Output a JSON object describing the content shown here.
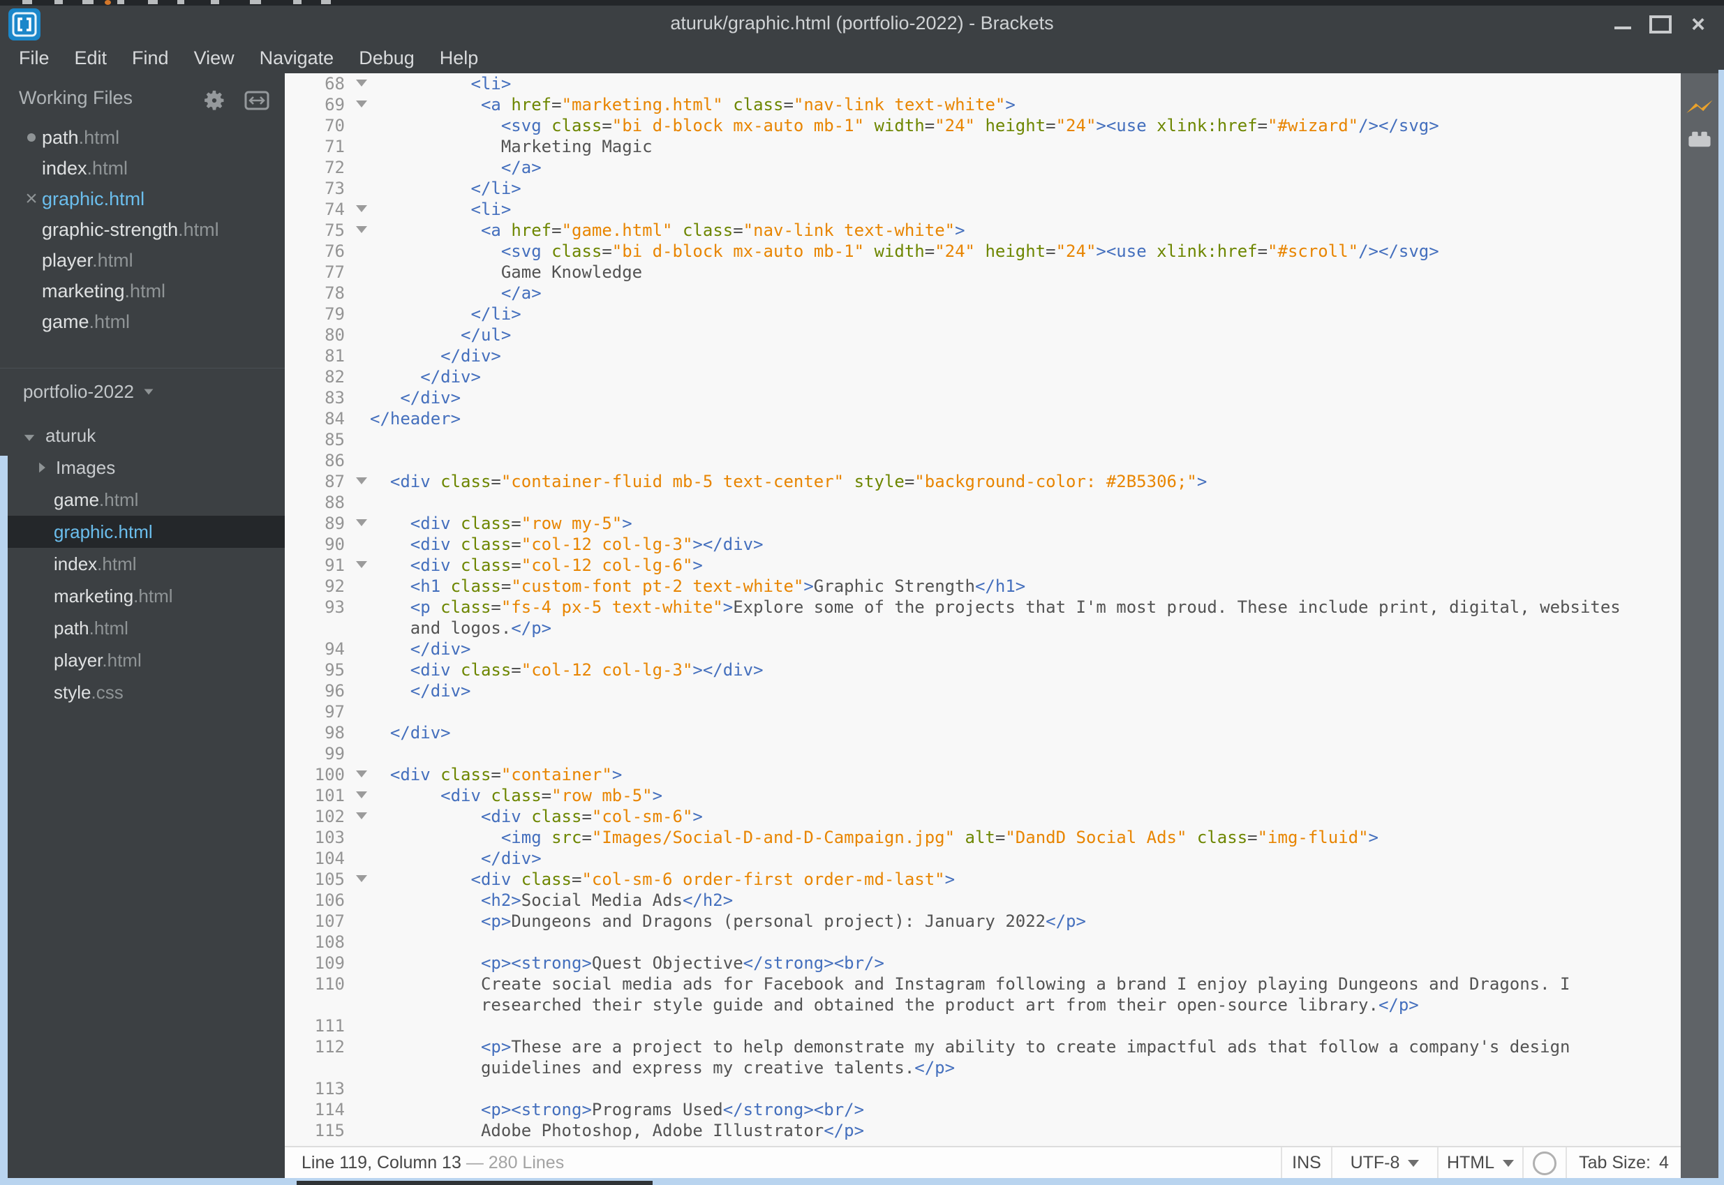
{
  "window": {
    "title": "aturuk/graphic.html (portfolio-2022) - Brackets",
    "controls": {
      "minimize": "minimize",
      "maximize": "maximize",
      "close": "close"
    }
  },
  "menubar": {
    "items": [
      "File",
      "Edit",
      "Find",
      "View",
      "Navigate",
      "Debug",
      "Help"
    ]
  },
  "sidebar": {
    "working_files_label": "Working Files",
    "working_files": [
      {
        "name": "path",
        "ext": ".html",
        "indicator": "dot"
      },
      {
        "name": "index",
        "ext": ".html",
        "indicator": "none"
      },
      {
        "name": "graphic",
        "ext": ".html",
        "indicator": "close",
        "active": true
      },
      {
        "name": "graphic-strength",
        "ext": ".html",
        "indicator": "none"
      },
      {
        "name": "player",
        "ext": ".html",
        "indicator": "none"
      },
      {
        "name": "marketing",
        "ext": ".html",
        "indicator": "none"
      },
      {
        "name": "game",
        "ext": ".html",
        "indicator": "none"
      }
    ],
    "project": {
      "name": "portfolio-2022"
    },
    "tree": [
      {
        "kind": "folder-open",
        "label": "aturuk",
        "level": 0
      },
      {
        "kind": "folder-closed",
        "label": "Images",
        "level": 1
      },
      {
        "kind": "file",
        "name": "game",
        "ext": ".html",
        "level": 1
      },
      {
        "kind": "file",
        "name": "graphic",
        "ext": ".html",
        "level": 1,
        "selected": true
      },
      {
        "kind": "file",
        "name": "index",
        "ext": ".html",
        "level": 1
      },
      {
        "kind": "file",
        "name": "marketing",
        "ext": ".html",
        "level": 1
      },
      {
        "kind": "file",
        "name": "path",
        "ext": ".html",
        "level": 1
      },
      {
        "kind": "file",
        "name": "player",
        "ext": ".html",
        "level": 1
      },
      {
        "kind": "file",
        "name": "style",
        "ext": ".css",
        "level": 1
      }
    ]
  },
  "editor": {
    "rows": [
      {
        "n": "68",
        "fold": true,
        "ind": 10,
        "seg": [
          [
            "t",
            "<li>"
          ]
        ]
      },
      {
        "n": "69",
        "fold": true,
        "ind": 11,
        "seg": [
          [
            "t",
            "<a"
          ],
          [
            "x",
            " "
          ],
          [
            "a",
            "href"
          ],
          [
            "p",
            "="
          ],
          [
            "s",
            "\"marketing.html\""
          ],
          [
            "x",
            " "
          ],
          [
            "a",
            "class"
          ],
          [
            "p",
            "="
          ],
          [
            "s",
            "\"nav-link text-white\""
          ],
          [
            "t",
            ">"
          ]
        ]
      },
      {
        "n": "70",
        "ind": 13,
        "seg": [
          [
            "t",
            "<svg"
          ],
          [
            "x",
            " "
          ],
          [
            "a",
            "class"
          ],
          [
            "p",
            "="
          ],
          [
            "s",
            "\"bi d-block mx-auto mb-1\""
          ],
          [
            "x",
            " "
          ],
          [
            "a",
            "width"
          ],
          [
            "p",
            "="
          ],
          [
            "s",
            "\"24\""
          ],
          [
            "x",
            " "
          ],
          [
            "a",
            "height"
          ],
          [
            "p",
            "="
          ],
          [
            "s",
            "\"24\""
          ],
          [
            "t",
            "><use"
          ],
          [
            "x",
            " "
          ],
          [
            "a",
            "xlink:href"
          ],
          [
            "p",
            "="
          ],
          [
            "s",
            "\"#wizard\""
          ],
          [
            "t",
            "/></svg>"
          ]
        ]
      },
      {
        "n": "71",
        "ind": 13,
        "seg": [
          [
            "x",
            "Marketing Magic"
          ]
        ]
      },
      {
        "n": "72",
        "ind": 13,
        "seg": [
          [
            "t",
            "</a>"
          ]
        ]
      },
      {
        "n": "73",
        "ind": 10,
        "seg": [
          [
            "t",
            "</li>"
          ]
        ]
      },
      {
        "n": "74",
        "fold": true,
        "ind": 10,
        "seg": [
          [
            "t",
            "<li>"
          ]
        ]
      },
      {
        "n": "75",
        "fold": true,
        "ind": 11,
        "seg": [
          [
            "t",
            "<a"
          ],
          [
            "x",
            " "
          ],
          [
            "a",
            "href"
          ],
          [
            "p",
            "="
          ],
          [
            "s",
            "\"game.html\""
          ],
          [
            "x",
            " "
          ],
          [
            "a",
            "class"
          ],
          [
            "p",
            "="
          ],
          [
            "s",
            "\"nav-link text-white\""
          ],
          [
            "t",
            ">"
          ]
        ]
      },
      {
        "n": "76",
        "ind": 13,
        "seg": [
          [
            "t",
            "<svg"
          ],
          [
            "x",
            " "
          ],
          [
            "a",
            "class"
          ],
          [
            "p",
            "="
          ],
          [
            "s",
            "\"bi d-block mx-auto mb-1\""
          ],
          [
            "x",
            " "
          ],
          [
            "a",
            "width"
          ],
          [
            "p",
            "="
          ],
          [
            "s",
            "\"24\""
          ],
          [
            "x",
            " "
          ],
          [
            "a",
            "height"
          ],
          [
            "p",
            "="
          ],
          [
            "s",
            "\"24\""
          ],
          [
            "t",
            "><use"
          ],
          [
            "x",
            " "
          ],
          [
            "a",
            "xlink:href"
          ],
          [
            "p",
            "="
          ],
          [
            "s",
            "\"#scroll\""
          ],
          [
            "t",
            "/></svg>"
          ]
        ]
      },
      {
        "n": "77",
        "ind": 13,
        "seg": [
          [
            "x",
            "Game Knowledge"
          ]
        ]
      },
      {
        "n": "78",
        "ind": 13,
        "seg": [
          [
            "t",
            "</a>"
          ]
        ]
      },
      {
        "n": "79",
        "ind": 10,
        "seg": [
          [
            "t",
            "</li>"
          ]
        ]
      },
      {
        "n": "80",
        "ind": 9,
        "seg": [
          [
            "t",
            "</ul>"
          ]
        ]
      },
      {
        "n": "81",
        "ind": 7,
        "seg": [
          [
            "t",
            "</div>"
          ]
        ]
      },
      {
        "n": "82",
        "ind": 5,
        "seg": [
          [
            "t",
            "</div>"
          ]
        ]
      },
      {
        "n": "83",
        "ind": 3,
        "seg": [
          [
            "t",
            "</div>"
          ]
        ]
      },
      {
        "n": "84",
        "ind": 0,
        "seg": [
          [
            "t",
            "</header>"
          ]
        ]
      },
      {
        "n": "85"
      },
      {
        "n": "86"
      },
      {
        "n": "87",
        "fold": true,
        "ind": 2,
        "seg": [
          [
            "t",
            "<div"
          ],
          [
            "x",
            " "
          ],
          [
            "a",
            "class"
          ],
          [
            "p",
            "="
          ],
          [
            "s",
            "\"container-fluid mb-5 text-center\""
          ],
          [
            "x",
            " "
          ],
          [
            "a",
            "style"
          ],
          [
            "p",
            "="
          ],
          [
            "s",
            "\"background-color: #2B5306;\""
          ],
          [
            "t",
            ">"
          ]
        ]
      },
      {
        "n": "88"
      },
      {
        "n": "89",
        "fold": true,
        "ind": 4,
        "seg": [
          [
            "t",
            "<div"
          ],
          [
            "x",
            " "
          ],
          [
            "a",
            "class"
          ],
          [
            "p",
            "="
          ],
          [
            "s",
            "\"row my-5\""
          ],
          [
            "t",
            ">"
          ]
        ]
      },
      {
        "n": "90",
        "ind": 4,
        "seg": [
          [
            "t",
            "<div"
          ],
          [
            "x",
            " "
          ],
          [
            "a",
            "class"
          ],
          [
            "p",
            "="
          ],
          [
            "s",
            "\"col-12 col-lg-3\""
          ],
          [
            "t",
            "></div>"
          ]
        ]
      },
      {
        "n": "91",
        "fold": true,
        "ind": 4,
        "seg": [
          [
            "t",
            "<div"
          ],
          [
            "x",
            " "
          ],
          [
            "a",
            "class"
          ],
          [
            "p",
            "="
          ],
          [
            "s",
            "\"col-12 col-lg-6\""
          ],
          [
            "t",
            ">"
          ]
        ]
      },
      {
        "n": "92",
        "ind": 4,
        "seg": [
          [
            "t",
            "<h1"
          ],
          [
            "x",
            " "
          ],
          [
            "a",
            "class"
          ],
          [
            "p",
            "="
          ],
          [
            "s",
            "\"custom-font pt-2 text-white\""
          ],
          [
            "t",
            ">"
          ],
          [
            "x",
            "Graphic Strength"
          ],
          [
            "t",
            "</h1>"
          ]
        ]
      },
      {
        "n": "93",
        "ind": 4,
        "seg": [
          [
            "t",
            "<p"
          ],
          [
            "x",
            " "
          ],
          [
            "a",
            "class"
          ],
          [
            "p",
            "="
          ],
          [
            "s",
            "\"fs-4 px-5 text-white\""
          ],
          [
            "t",
            ">"
          ],
          [
            "x",
            "Explore some of the projects that I'm most proud. These include print, digital, websites"
          ]
        ]
      },
      {
        "n": "",
        "ind": 4,
        "seg": [
          [
            "x",
            "and logos."
          ],
          [
            "t",
            "</p>"
          ]
        ]
      },
      {
        "n": "94",
        "ind": 4,
        "seg": [
          [
            "t",
            "</div>"
          ]
        ]
      },
      {
        "n": "95",
        "ind": 4,
        "seg": [
          [
            "t",
            "<div"
          ],
          [
            "x",
            " "
          ],
          [
            "a",
            "class"
          ],
          [
            "p",
            "="
          ],
          [
            "s",
            "\"col-12 col-lg-3\""
          ],
          [
            "t",
            "></div>"
          ]
        ]
      },
      {
        "n": "96",
        "ind": 4,
        "seg": [
          [
            "t",
            "</div>"
          ]
        ]
      },
      {
        "n": "97"
      },
      {
        "n": "98",
        "ind": 2,
        "seg": [
          [
            "t",
            "</div>"
          ]
        ]
      },
      {
        "n": "99"
      },
      {
        "n": "100",
        "fold": true,
        "ind": 2,
        "seg": [
          [
            "t",
            "<div"
          ],
          [
            "x",
            " "
          ],
          [
            "a",
            "class"
          ],
          [
            "p",
            "="
          ],
          [
            "s",
            "\"container\""
          ],
          [
            "t",
            ">"
          ]
        ]
      },
      {
        "n": "101",
        "fold": true,
        "ind": 7,
        "seg": [
          [
            "t",
            "<div"
          ],
          [
            "x",
            " "
          ],
          [
            "a",
            "class"
          ],
          [
            "p",
            "="
          ],
          [
            "s",
            "\"row mb-5\""
          ],
          [
            "t",
            ">"
          ]
        ]
      },
      {
        "n": "102",
        "fold": true,
        "ind": 11,
        "seg": [
          [
            "t",
            "<div"
          ],
          [
            "x",
            " "
          ],
          [
            "a",
            "class"
          ],
          [
            "p",
            "="
          ],
          [
            "s",
            "\"col-sm-6\""
          ],
          [
            "t",
            ">"
          ]
        ]
      },
      {
        "n": "103",
        "ind": 13,
        "seg": [
          [
            "t",
            "<img"
          ],
          [
            "x",
            " "
          ],
          [
            "a",
            "src"
          ],
          [
            "p",
            "="
          ],
          [
            "s",
            "\"Images/Social-D-and-D-Campaign.jpg\""
          ],
          [
            "x",
            " "
          ],
          [
            "a",
            "alt"
          ],
          [
            "p",
            "="
          ],
          [
            "s",
            "\"DandD Social Ads\""
          ],
          [
            "x",
            " "
          ],
          [
            "a",
            "class"
          ],
          [
            "p",
            "="
          ],
          [
            "s",
            "\"img-fluid\""
          ],
          [
            "t",
            ">"
          ]
        ]
      },
      {
        "n": "104",
        "ind": 11,
        "seg": [
          [
            "t",
            "</div>"
          ]
        ]
      },
      {
        "n": "105",
        "fold": true,
        "ind": 10,
        "seg": [
          [
            "t",
            "<div"
          ],
          [
            "x",
            " "
          ],
          [
            "a",
            "class"
          ],
          [
            "p",
            "="
          ],
          [
            "s",
            "\"col-sm-6 order-first order-md-last\""
          ],
          [
            "t",
            ">"
          ]
        ]
      },
      {
        "n": "106",
        "ind": 11,
        "seg": [
          [
            "t",
            "<h2>"
          ],
          [
            "x",
            "Social Media Ads"
          ],
          [
            "t",
            "</h2>"
          ]
        ]
      },
      {
        "n": "107",
        "ind": 11,
        "seg": [
          [
            "t",
            "<p>"
          ],
          [
            "x",
            "Dungeons and Dragons (personal project): January 2022"
          ],
          [
            "t",
            "</p>"
          ]
        ]
      },
      {
        "n": "108"
      },
      {
        "n": "109",
        "ind": 11,
        "seg": [
          [
            "t",
            "<p><strong>"
          ],
          [
            "x",
            "Quest Objective"
          ],
          [
            "t",
            "</strong><br/>"
          ]
        ]
      },
      {
        "n": "110",
        "ind": 11,
        "seg": [
          [
            "x",
            "Create social media ads for Facebook and Instagram following a brand I enjoy playing Dungeons and Dragons. I"
          ]
        ]
      },
      {
        "n": "",
        "ind": 11,
        "seg": [
          [
            "x",
            "researched their style guide and obtained the product art from their open-source library."
          ],
          [
            "t",
            "</p>"
          ]
        ]
      },
      {
        "n": "111"
      },
      {
        "n": "112",
        "ind": 11,
        "seg": [
          [
            "t",
            "<p>"
          ],
          [
            "x",
            "These are a project to help demonstrate my ability to create impactful ads that follow a company's design"
          ]
        ]
      },
      {
        "n": "",
        "ind": 11,
        "seg": [
          [
            "x",
            "guidelines and express my creative talents."
          ],
          [
            "t",
            "</p>"
          ]
        ]
      },
      {
        "n": "113"
      },
      {
        "n": "114",
        "ind": 11,
        "seg": [
          [
            "t",
            "<p><strong>"
          ],
          [
            "x",
            "Programs Used"
          ],
          [
            "t",
            "</strong><br/>"
          ]
        ]
      },
      {
        "n": "115",
        "ind": 11,
        "seg": [
          [
            "x",
            "Adobe Photoshop, Adobe Illustrator"
          ],
          [
            "t",
            "</p>"
          ]
        ]
      }
    ]
  },
  "statusbar": {
    "cursor": "Line 119, Column 13",
    "dash": "—",
    "total": "280 Lines",
    "ins": "INS",
    "encoding": "UTF-8",
    "language": "HTML",
    "tabsize_label": "Tab Size:",
    "tabsize_value": "4"
  },
  "colors": {
    "titlebar_bg": "#3c4043",
    "sidebar_bg": "#3c4043",
    "editor_bg": "#f8f8f8",
    "toolbar_bg": "#5f6367",
    "active_file_blue": "#6bbeed",
    "syntax_tag": "#446fbd",
    "syntax_attribute": "#6d8600",
    "syntax_string": "#e88501",
    "syntax_text": "#535353",
    "live_preview_bolt": "#eaa22b",
    "edge_blue": "#b9d4ef",
    "inline_style_value": "#2B5306"
  }
}
